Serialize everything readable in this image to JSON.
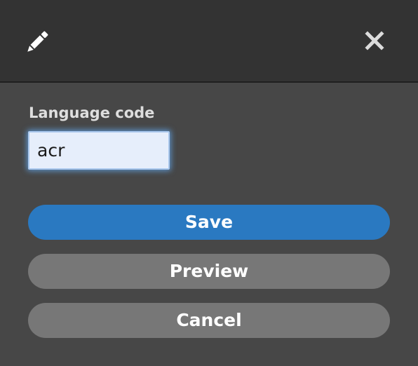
{
  "header": {
    "edit_icon": "pencil-icon",
    "close_icon": "close-icon"
  },
  "form": {
    "label": "Language code",
    "input_value": "acr"
  },
  "buttons": {
    "save": "Save",
    "preview": "Preview",
    "cancel": "Cancel"
  },
  "colors": {
    "header_bg": "#333333",
    "body_bg": "#474747",
    "primary": "#2a79c1",
    "secondary": "#777777",
    "input_bg": "#e6eefb",
    "focus_glow": "#62a5eb"
  }
}
